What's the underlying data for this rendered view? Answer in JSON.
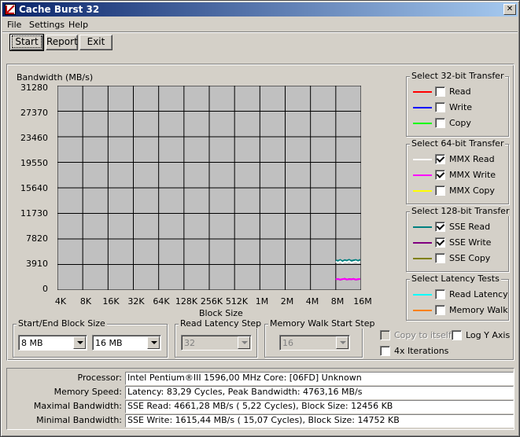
{
  "window": {
    "title": "Cache Burst 32",
    "close_glyph": "✕"
  },
  "menu": [
    "File",
    "Settings",
    "Help"
  ],
  "toolbar": {
    "start": "Start",
    "report": "Report",
    "exit": "Exit"
  },
  "chart_data": {
    "type": "line",
    "ylabel": "Bandwidth (MB/s)",
    "xlabel": "Block Size",
    "yticks": [
      "31280",
      "27370",
      "23460",
      "19550",
      "15640",
      "11730",
      "7820",
      "3910",
      "0"
    ],
    "ylim": [
      0,
      31280
    ],
    "x_categories": [
      "4K",
      "8K",
      "16K",
      "32K",
      "64K",
      "128K",
      "256K",
      "512K",
      "1M",
      "2M",
      "4M",
      "8M",
      "16M"
    ],
    "grid": true,
    "series": [
      {
        "name": "SSE Read",
        "color": "#008080",
        "x_range": [
          "8M",
          "16M"
        ],
        "values": [
          4560,
          4480,
          4620,
          4400,
          4590,
          4500,
          4630,
          4470,
          4560,
          4610,
          4480,
          4660
        ]
      },
      {
        "name": "MMX Read",
        "color": "#ffffff",
        "x_range": [
          "8M",
          "16M"
        ],
        "values": [
          4340,
          4200,
          4400,
          4150,
          4360,
          4250,
          4420,
          4180,
          4300,
          4390,
          4220,
          4380
        ]
      },
      {
        "name": "SSE Write",
        "color": "#800080",
        "x_range": [
          "8M",
          "16M"
        ],
        "values": [
          1620,
          1700,
          1580,
          1660,
          1720,
          1600,
          1680,
          1640,
          1710,
          1590,
          1650,
          1700
        ]
      },
      {
        "name": "MMX Write",
        "color": "#ff00ff",
        "x_range": [
          "8M",
          "16M"
        ],
        "values": [
          1640,
          1680,
          1600,
          1690,
          1700,
          1620,
          1660,
          1650,
          1690,
          1610,
          1670,
          1680
        ]
      }
    ]
  },
  "groups": {
    "t32": {
      "title": "Select 32-bit Transfer",
      "items": [
        {
          "label": "Read",
          "color": "#ff0000",
          "checked": false
        },
        {
          "label": "Write",
          "color": "#0000ff",
          "checked": false
        },
        {
          "label": "Copy",
          "color": "#00ff00",
          "checked": false
        }
      ]
    },
    "t64": {
      "title": "Select 64-bit Transfer",
      "items": [
        {
          "label": "MMX Read",
          "color": "#ffffff",
          "checked": true
        },
        {
          "label": "MMX Write",
          "color": "#ff00ff",
          "checked": true
        },
        {
          "label": "MMX Copy",
          "color": "#ffff00",
          "checked": false
        }
      ]
    },
    "t128": {
      "title": "Select 128-bit Transfer",
      "items": [
        {
          "label": "SSE Read",
          "color": "#008080",
          "checked": true
        },
        {
          "label": "SSE Write",
          "color": "#800080",
          "checked": true
        },
        {
          "label": "SSE Copy",
          "color": "#808000",
          "checked": false
        }
      ]
    },
    "latency": {
      "title": "Select Latency Tests",
      "items": [
        {
          "label": "Read Latency",
          "color": "#00ffff",
          "checked": false
        },
        {
          "label": "Memory Walk",
          "color": "#ff8000",
          "checked": false
        }
      ]
    }
  },
  "block_size": {
    "title": "Start/End Block Size",
    "start": "8 MB",
    "end": "16 MB"
  },
  "read_latency": {
    "title": "Read Latency Step",
    "value": "32"
  },
  "memory_walk": {
    "title": "Memory Walk Start Step",
    "value": "16"
  },
  "options": {
    "copy_to_itself": "Copy to itself",
    "log_y_axis": "Log Y Axis",
    "iterations_4x": "4x Iterations"
  },
  "info": {
    "processor_label": "Processor:",
    "processor_value": "Intel Pentium®III 1596,00 MHz   Core: [06FD] Unknown",
    "memory_speed_label": "Memory Speed:",
    "memory_speed_value": "Latency:  83,29 Cycles, Peak Bandwidth:  4763,16 MB/s",
    "max_bw_label": "Maximal Bandwidth:",
    "max_bw_value": "SSE Read:  4661,28 MB/s (  5,22 Cycles), Block Size: 12456 KB",
    "min_bw_label": "Minimal Bandwidth:",
    "min_bw_value": "SSE Write:  1615,44 MB/s ( 15,07 Cycles), Block Size: 14752 KB"
  }
}
